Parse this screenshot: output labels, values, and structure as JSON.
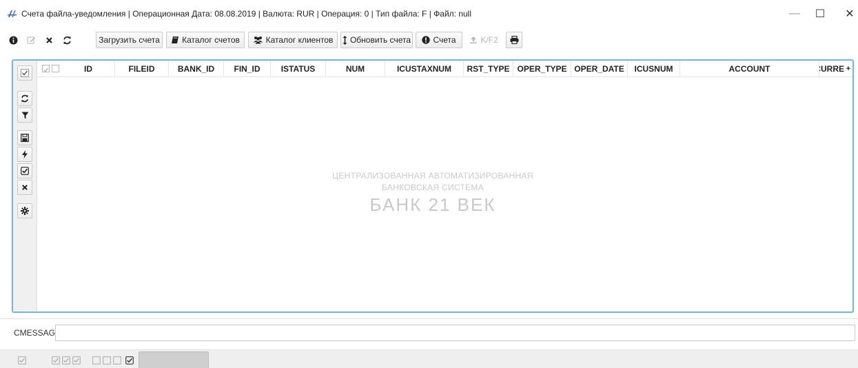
{
  "window": {
    "title": "Счета файла-уведомления | Операционная Дата: 08.08.2019  | Валюта: RUR | Операция: 0 | Тип файла: F | Файл: null",
    "minimize": "—",
    "maximize": "☐",
    "close": "✕"
  },
  "toolbar": {
    "upload_label": "Загрузить счета",
    "accounts_catalog_label": "Каталог счетов",
    "clients_catalog_label": "Каталог клиентов",
    "update_accounts_label": "Обновить счета",
    "accounts_label": "Счета",
    "kf2_label": "K/F2"
  },
  "table": {
    "columns": [
      "ID",
      "FILEID",
      "BANK_ID",
      "FIN_ID",
      "ISTATUS",
      "NUM",
      "ICUSTAXNUM",
      "RST_TYPE",
      "OPER_TYPE",
      "OPER_DATE",
      "ICUSNUM",
      "ACCOUNT",
      "CURRE"
    ],
    "more_indicator": "+"
  },
  "watermark": {
    "line1": "ЦЕНТРАЛИЗОВАННАЯ АВТОМАТИЗИРОВАННАЯ",
    "line2": "БАНКОВСКАЯ СИСТЕМА",
    "line3": "БАНК 21 ВЕК"
  },
  "cmessage": {
    "label": "CMESSAGE",
    "value": ""
  },
  "colors": {
    "panel_border": "#6fb6e6",
    "watermark": "#c9c9c9",
    "logo": "#3b6fb0"
  }
}
